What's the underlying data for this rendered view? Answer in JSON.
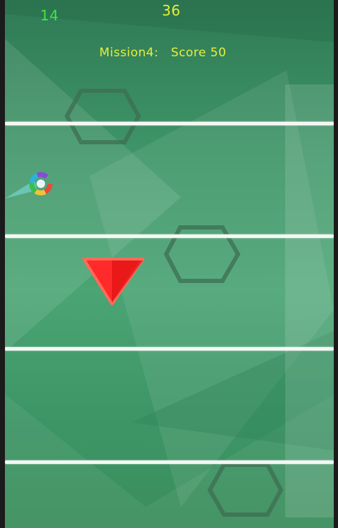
{
  "hud": {
    "level_count": "14",
    "score_count": "36",
    "mission_label": "Mission4:",
    "mission_goal": "Score 50"
  },
  "colors": {
    "level_count": "#3ee83e",
    "score_count": "#e8ef3a",
    "mission_text": "#e8ef3a",
    "lane_line": "#f4f7f4",
    "triangle": "#ff1a1a",
    "background": "#3f9668"
  },
  "objects": {
    "player": "rainbow-ring-ball",
    "hazard": "red-triangle",
    "obstacle": "hexagon-outline"
  }
}
